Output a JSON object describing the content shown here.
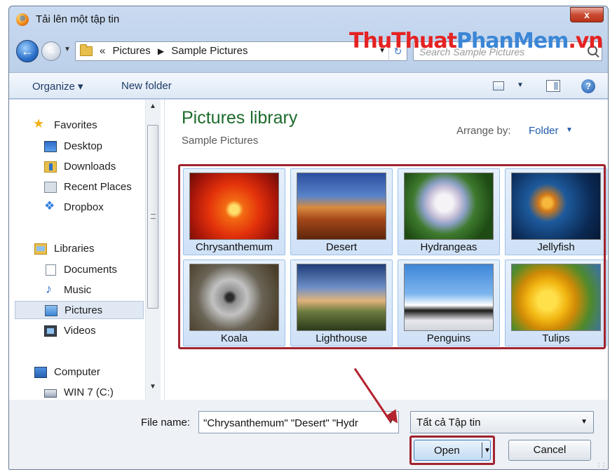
{
  "window": {
    "title": "Tải lên một tập tin",
    "close_label": "x"
  },
  "watermark": {
    "part1": "ThuThuat",
    "part2": "PhanMem",
    "part3": ".vn"
  },
  "address": {
    "overflow": "«",
    "crumbs": [
      "Pictures",
      "Sample Pictures"
    ],
    "search_placeholder": "Search Sample Pictures"
  },
  "toolbar": {
    "organize": "Organize ▾",
    "new_folder": "New folder",
    "help_label": "?"
  },
  "nav": {
    "favorites": "Favorites",
    "desktop": "Desktop",
    "downloads": "Downloads",
    "recent_places": "Recent Places",
    "dropbox": "Dropbox",
    "libraries": "Libraries",
    "documents": "Documents",
    "music": "Music",
    "pictures": "Pictures",
    "videos": "Videos",
    "computer": "Computer",
    "drive": "WIN 7 (C:)"
  },
  "content": {
    "title": "Pictures library",
    "subtitle": "Sample Pictures",
    "arrange_label": "Arrange by:",
    "arrange_value": "Folder"
  },
  "files": [
    {
      "name": "Chrysanthemum"
    },
    {
      "name": "Desert"
    },
    {
      "name": "Hydrangeas"
    },
    {
      "name": "Jellyfish"
    },
    {
      "name": "Koala"
    },
    {
      "name": "Lighthouse"
    },
    {
      "name": "Penguins"
    },
    {
      "name": "Tulips"
    }
  ],
  "bottom": {
    "file_name_label": "File name:",
    "file_name_value": "\"Chrysanthemum\" \"Desert\" \"Hydr",
    "file_type": "Tất cả Tập tin",
    "open_label": "Open",
    "cancel_label": "Cancel"
  },
  "colors": {
    "highlight": "#a0232f",
    "library_title": "#1d6b2c",
    "link": "#1e5aa8"
  }
}
